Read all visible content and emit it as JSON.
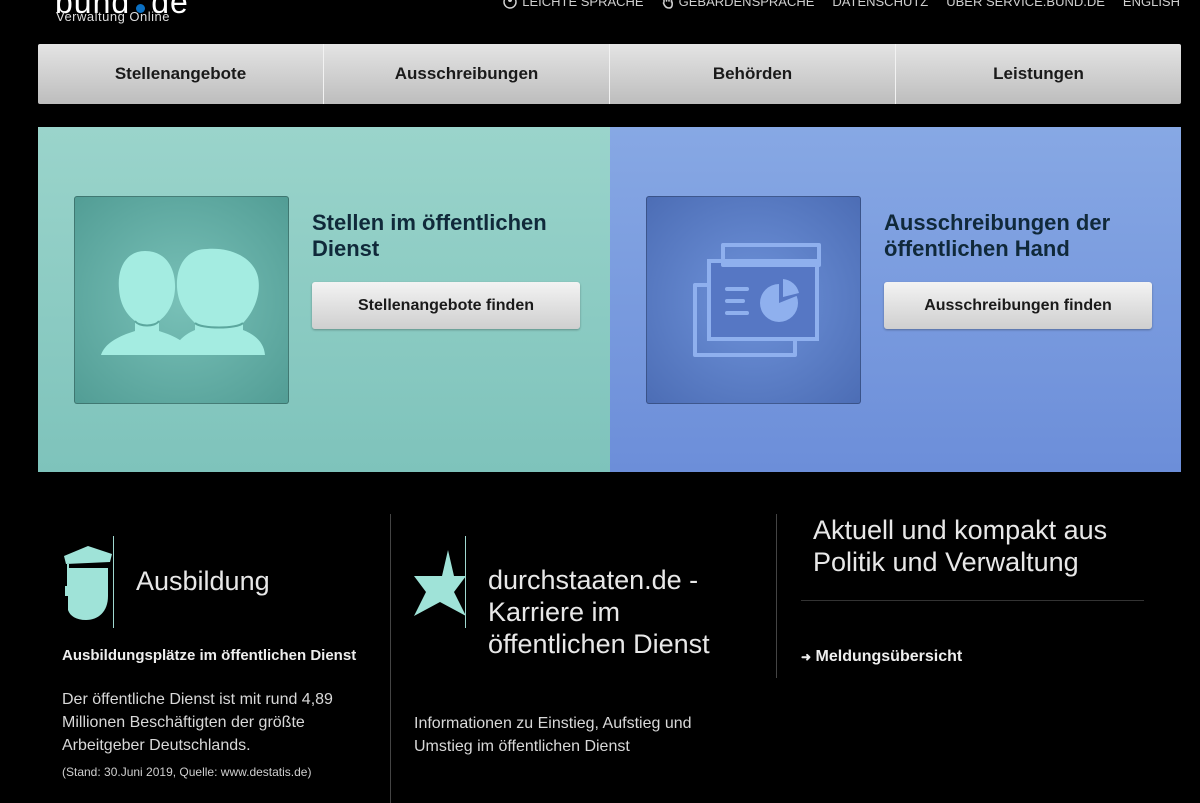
{
  "logo": {
    "word_left": "bund",
    "word_right": "de",
    "sub": "Verwaltung Online"
  },
  "topnav": [
    {
      "icon": "leichte-sprache-icon",
      "label": "LEICHTE SPRACHE"
    },
    {
      "icon": "hand-icon",
      "label": "GEBÄRDENSPRACHE"
    },
    {
      "label": "DATENSCHUTZ"
    },
    {
      "label": "ÜBER SERVICE.BUND.DE"
    },
    {
      "label": "ENGLISH"
    }
  ],
  "mainnav": [
    "Stellenangebote",
    "Ausschreibungen",
    "Behörden",
    "Leistungen"
  ],
  "hero": {
    "left": {
      "title": "Stellen im öffentlichen Dienst",
      "button": "Stellenangebote finden",
      "icon": "people-icon",
      "color": "#9ad4cb"
    },
    "right": {
      "title": "Ausschreibungen der öffentlichen Hand",
      "button": "Ausschreibungen finden",
      "icon": "presentation-icon",
      "color": "#87a8e4"
    }
  },
  "ausbildung": {
    "icon": "graduate-icon",
    "title": "Ausbildung",
    "subtitle": "Ausbildungsplätze im öffentlichen Dienst",
    "text": "Der öffentliche Dienst ist mit rund 4,89 Millionen Beschäftigten der größte Arbeitgeber Deutschlands.",
    "source": "(Stand: 30.Juni 2019, Quelle: www.destatis.de)"
  },
  "durchstaaten": {
    "icon": "star-icon",
    "title": "durchstaaten.de - Karriere im öffentlichen Dienst",
    "text": "Informationen zu Einstieg, Aufstieg und Umstieg im öffentlichen Dienst"
  },
  "aktuell": {
    "title": "Aktuell und kompakt aus Politik und Verwaltung",
    "link": "Meldungsübersicht"
  }
}
